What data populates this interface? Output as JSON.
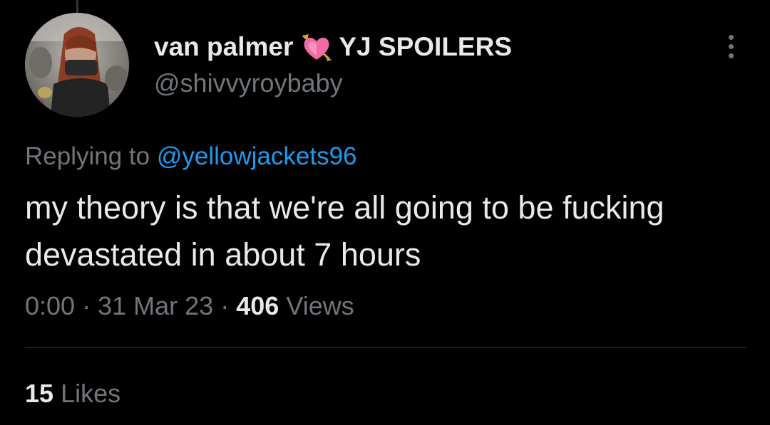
{
  "tweet": {
    "author": {
      "name": "van palmer",
      "name_suffix": "YJ SPOILERS",
      "handle": "@shivvyroybaby",
      "name_emoji": "heart-with-arrow-icon"
    },
    "reply": {
      "prefix": "Replying to",
      "to_handle": "@yellowjackets96"
    },
    "text": "my theory is that we're all going to be fucking devastated in about 7 hours",
    "meta": {
      "time": "0:00",
      "separator": "·",
      "date": "31 Mar 23",
      "views_count": "406",
      "views_label": "Views"
    },
    "stats": {
      "likes_count": "15",
      "likes_label": "Likes"
    }
  },
  "colors": {
    "background": "#000000",
    "text_primary": "#e7e9ea",
    "text_secondary": "#71767b",
    "link": "#1d9bf0",
    "divider": "#2f3336"
  },
  "icons": {
    "more": "more-options-icon",
    "avatar": "profile-avatar"
  }
}
